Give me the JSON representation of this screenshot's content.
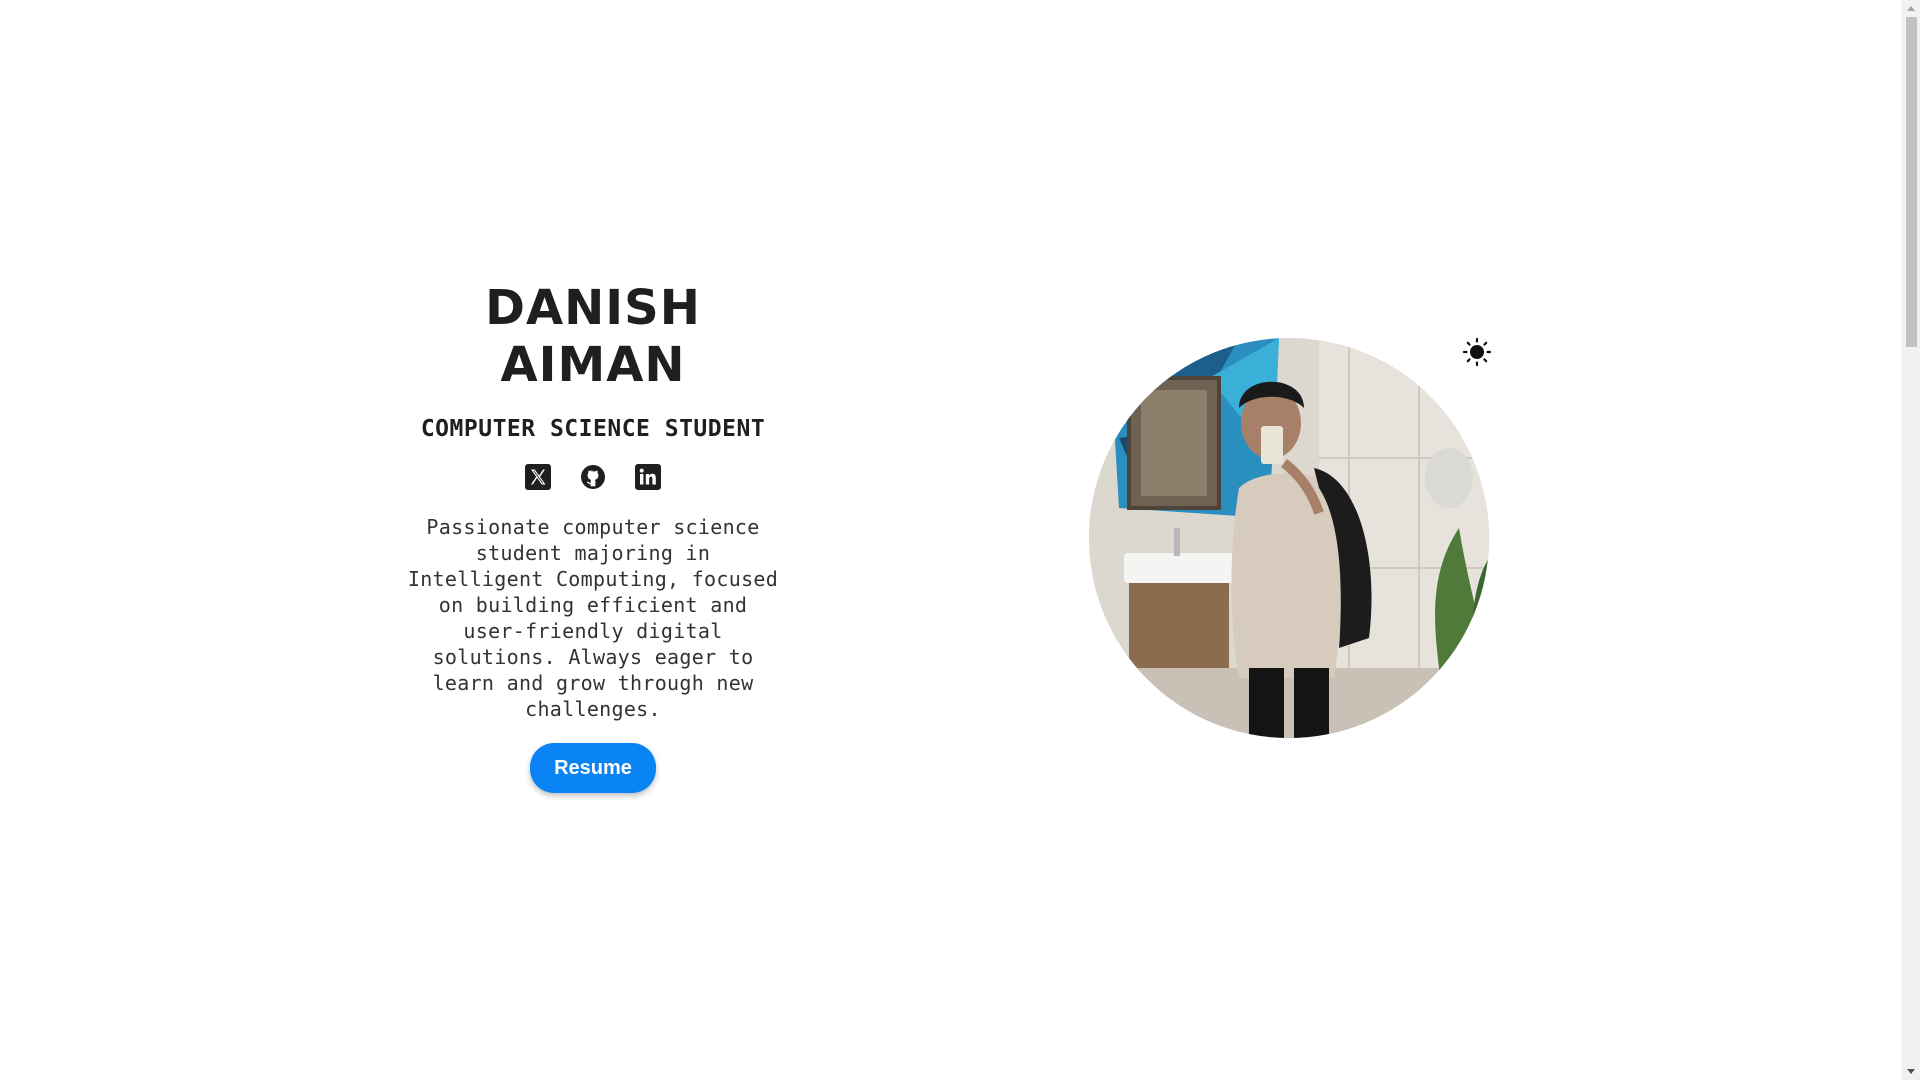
{
  "hero": {
    "name_line1": "DANISH",
    "name_line2": "AIMAN",
    "subtitle": "COMPUTER SCIENCE STUDENT",
    "bio": "Passionate computer science student majoring in Intelligent Computing, focused on building efficient and user-friendly digital solutions. Always eager to learn and grow through new challenges.",
    "resume_label": "Resume"
  },
  "socials": [
    {
      "icon": "x-twitter-icon"
    },
    {
      "icon": "github-icon"
    },
    {
      "icon": "linkedin-icon"
    }
  ],
  "theme_toggle": {
    "icon": "sun-icon"
  },
  "colors": {
    "text": "#1f1f1f",
    "accent": "#0a84f5",
    "background": "#ffffff"
  }
}
